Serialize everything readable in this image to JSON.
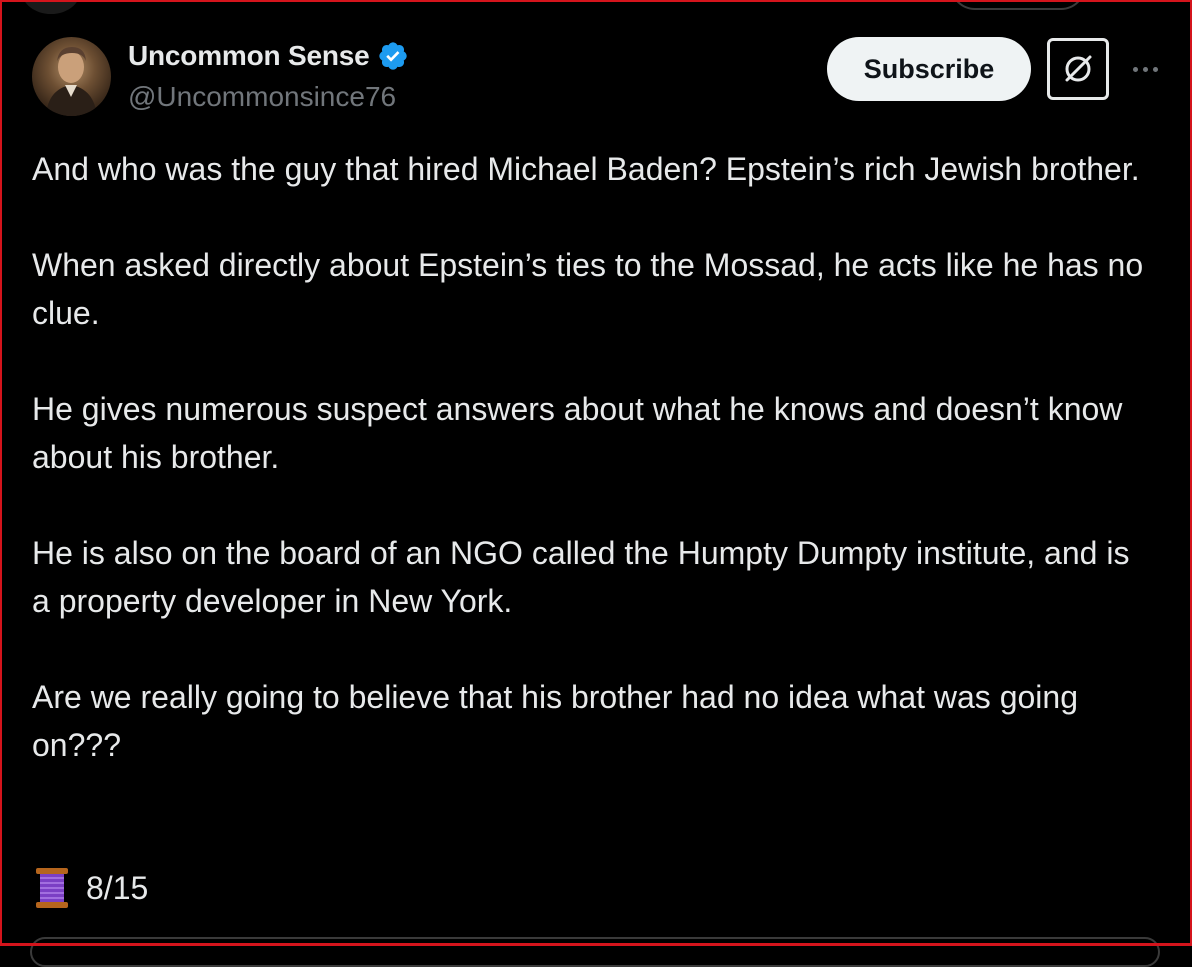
{
  "author": {
    "display_name": "Uncommon Sense",
    "handle": "@Uncommonsince76",
    "verified": true,
    "avatar_icon": "portrait-avatar"
  },
  "actions": {
    "subscribe_label": "Subscribe",
    "grok_icon": "grok-icon",
    "more_icon": "more-icon"
  },
  "tweet": {
    "paragraphs": [
      "And who was the guy that hired Michael Baden? Epstein’s rich Jewish brother.",
      "When asked directly about Epstein’s ties to the Mossad, he acts like he has no clue.",
      "He gives numerous suspect answers about what he knows and doesn’t know about his brother.",
      "He is also on the board of an NGO called the Humpty Dumpty institute, and is a property developer in New York.",
      "Are we really going to believe that his brother had no idea what was going on???"
    ],
    "thread_icon": "thread-spool-icon",
    "thread_count": "8/15"
  },
  "colors": {
    "background": "#000000",
    "text_primary": "#e7e9ea",
    "text_secondary": "#71767b",
    "verified_blue": "#1d9bf0",
    "frame_red": "#d4141c",
    "button_bg": "#eff3f4"
  }
}
